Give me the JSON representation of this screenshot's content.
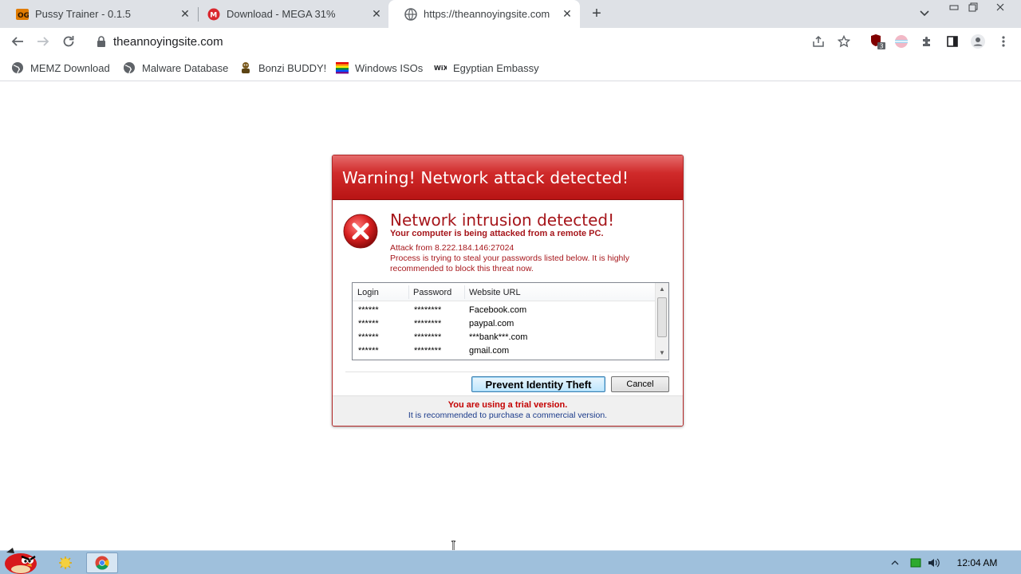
{
  "browser": {
    "tabs": [
      {
        "title": "Pussy Trainer - 0.1.5",
        "icon": "og-icon",
        "active": false
      },
      {
        "title": "Download - MEGA 31%",
        "icon": "mega-icon",
        "active": false
      },
      {
        "title": "https://theannoyingsite.com",
        "icon": "globe-icon",
        "active": true
      }
    ],
    "url": "theannoyingsite.com",
    "extension_badge": "3"
  },
  "bookmarks": [
    {
      "label": "MEMZ Download",
      "icon": "globe-icon"
    },
    {
      "label": "Malware Database",
      "icon": "globe-icon"
    },
    {
      "label": "Bonzi BUDDY!",
      "icon": "bonzi-icon"
    },
    {
      "label": "Windows ISOs",
      "icon": "rainbow-icon"
    },
    {
      "label": "Egyptian Embassy",
      "icon": "wix-icon"
    }
  ],
  "dialog": {
    "window_title": "Warning! Network attack detected!",
    "headline": "Network intrusion detected!",
    "subheadline": "Your computer is being attacked from a remote PC.",
    "attack_source": "Attack from 8.222.184.146:27024",
    "description": "Process is trying to steal your passwords listed below. It is highly recommended to block this threat now.",
    "table": {
      "columns": [
        "Login",
        "Password",
        "Website URL"
      ],
      "rows": [
        [
          "******",
          "********",
          "Facebook.com"
        ],
        [
          "******",
          "********",
          "paypal.com"
        ],
        [
          "******",
          "********",
          "***bank***.com"
        ],
        [
          "******",
          "********",
          "gmail.com"
        ]
      ]
    },
    "primary_button": "Prevent Identity Theft",
    "cancel_button": "Cancel",
    "trial_notice": "You are using a trial version.",
    "purchase_notice": "It is recommended to purchase a commercial version.",
    "accent_color": "#b81414"
  },
  "taskbar": {
    "clock": "12:04 AM"
  }
}
